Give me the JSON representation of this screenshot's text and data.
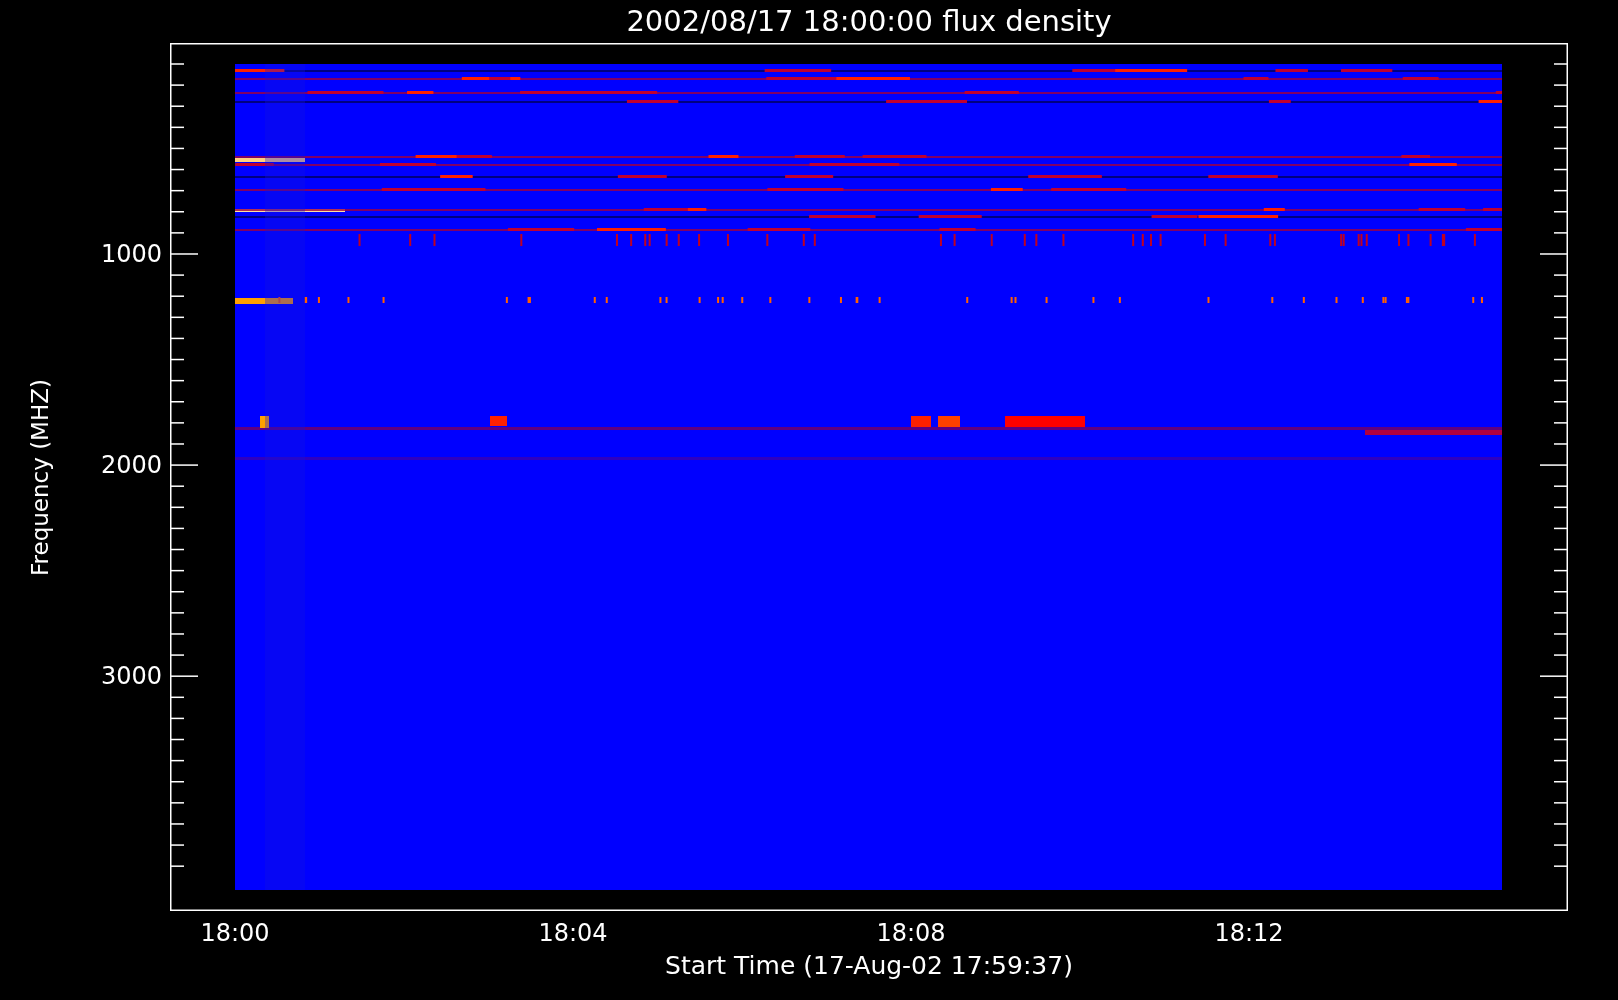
{
  "title": "2002/08/17 18:00:00 flux density",
  "y_axis": {
    "title": "Frequency (MHZ)",
    "ticks": [
      "1000",
      "2000",
      "3000"
    ]
  },
  "x_axis": {
    "title": "Start Time (17-Aug-02 17:59:37)",
    "ticks": [
      "18:00",
      "18:04",
      "18:08",
      "18:12"
    ]
  }
}
